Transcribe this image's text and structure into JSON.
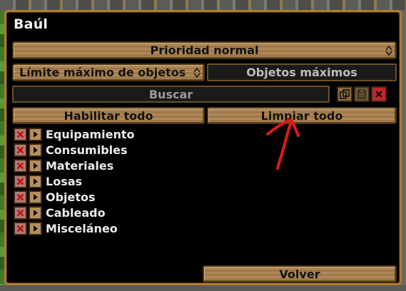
{
  "window": {
    "title": "Baúl"
  },
  "priority": {
    "label": "Prioridad normal"
  },
  "limit": {
    "label": "Límite máximo de objetos",
    "value_label": "Objetos máximos"
  },
  "search": {
    "placeholder": "Buscar"
  },
  "actions": {
    "enable_all": "Habilitar todo",
    "clear_all": "Limpiar todo",
    "back": "Volver"
  },
  "categories": [
    {
      "label": "Equipamiento"
    },
    {
      "label": "Consumibles"
    },
    {
      "label": "Materiales"
    },
    {
      "label": "Losas"
    },
    {
      "label": "Objetos"
    },
    {
      "label": "Cableado"
    },
    {
      "label": "Misceláneo"
    }
  ],
  "icons": {
    "updown": "up-down-arrow-icon",
    "copy": "copy-icon",
    "paste": "paste-icon",
    "close": "close-icon",
    "remove": "red-x-icon",
    "expand": "expand-triangle-icon"
  },
  "colors": {
    "frame": "#b07c2c",
    "wood": "#a57e4f",
    "close_red": "#c0262a",
    "annotation_red": "#e01818"
  }
}
